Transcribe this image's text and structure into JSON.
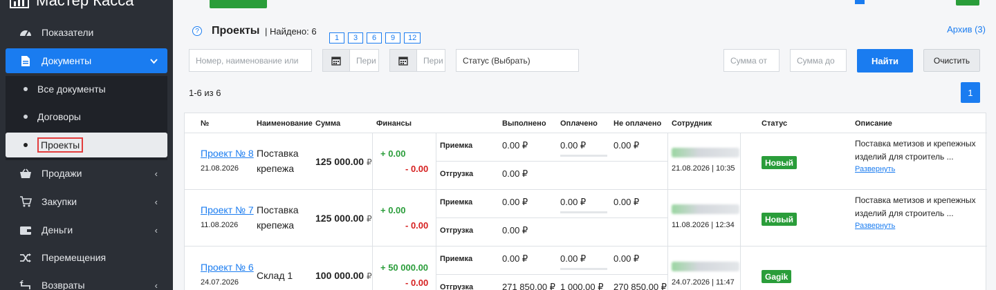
{
  "app": {
    "brand": "Мастер Касса"
  },
  "sidebar": {
    "items": [
      {
        "label": "Показатели",
        "icon": "dashboard-icon"
      },
      {
        "label": "Документы",
        "icon": "document-icon",
        "chevron": "⌄"
      },
      {
        "label": "Продажи",
        "icon": "basket-icon",
        "chevron": "‹"
      },
      {
        "label": "Закупки",
        "icon": "cart-icon",
        "chevron": "‹"
      },
      {
        "label": "Деньги",
        "icon": "wallet-icon",
        "chevron": "‹"
      },
      {
        "label": "Перемещения",
        "icon": "shuffle-icon"
      },
      {
        "label": "Возвраты",
        "icon": "return-icon",
        "chevron": "‹"
      }
    ],
    "submenu": [
      {
        "label": "Все документы"
      },
      {
        "label": "Договоры"
      },
      {
        "label": "Проекты"
      }
    ]
  },
  "header": {
    "help": "?",
    "title": "Проекты",
    "found": "| Найдено: 6",
    "chips": [
      "1",
      "3",
      "6",
      "9",
      "12"
    ],
    "archive": "Архив (3)"
  },
  "filters": {
    "search_placeholder": "Номер, наименование или",
    "date1_placeholder": "Пери",
    "date2_placeholder": "Пери",
    "status": "Статус (Выбрать)",
    "sum_from": "Сумма от",
    "sum_to": "Сумма до",
    "find": "Найти",
    "clear": "Очистить"
  },
  "range": "1-6 из 6",
  "page": "1",
  "table": {
    "headers": [
      "№",
      "Наименование",
      "Сумма",
      "Финансы",
      "Выполнено",
      "Оплачено",
      "Не оплачено",
      "Сотрудник",
      "Статус",
      "Описание"
    ],
    "row_labels": [
      "Приемка",
      "Отгрузка"
    ],
    "expand": "Развернуть",
    "rows": [
      {
        "link": "Проект № 8",
        "date": "21.08.2026",
        "name1": "Поставка",
        "name2": "крепежа",
        "sum": "125 000.00",
        "cur": "₽",
        "plus": "+ 0.00",
        "minus": "- 0.00",
        "p_done": "0.00 ₽",
        "p_paid": "0.00 ₽",
        "p_unpaid": "0.00 ₽",
        "o_done": "0.00 ₽",
        "o_paid": "",
        "o_unpaid": "",
        "emp_date": "21.08.2026 | 10:35",
        "status": "Новый",
        "desc1": "Поставка метизов и крепежных",
        "desc2": "изделий для строитель ..."
      },
      {
        "link": "Проект № 7",
        "date": "11.08.2026",
        "name1": "Поставка",
        "name2": "крепежа",
        "sum": "125 000.00",
        "cur": "₽",
        "plus": "+ 0.00",
        "minus": "- 0.00",
        "p_done": "0.00 ₽",
        "p_paid": "0.00 ₽",
        "p_unpaid": "0.00 ₽",
        "o_done": "0.00 ₽",
        "o_paid": "",
        "o_unpaid": "",
        "emp_date": "11.08.2026 | 12:34",
        "status": "Новый",
        "desc1": "Поставка метизов и крепежных",
        "desc2": "изделий для строитель ..."
      },
      {
        "link": "Проект № 6",
        "date": "24.07.2026",
        "name1": "Склад 1",
        "name2": "",
        "sum": "100 000.00",
        "cur": "₽",
        "plus": "+ 50 000.00",
        "minus": "- 0.00",
        "p_done": "0.00 ₽",
        "p_paid": "0.00 ₽",
        "p_unpaid": "0.00 ₽",
        "o_done": "271 850.00 ₽",
        "o_paid": "1 000.00 ₽",
        "o_unpaid": "270 850.00 ₽",
        "emp_date": "24.07.2026 | 11:47",
        "status": "Gagik",
        "desc1": "",
        "desc2": ""
      }
    ]
  },
  "colors": {
    "accent": "#1a7cf0",
    "green": "#2a9d3a",
    "red": "#d62020",
    "sidebar": "#2b2f36"
  }
}
